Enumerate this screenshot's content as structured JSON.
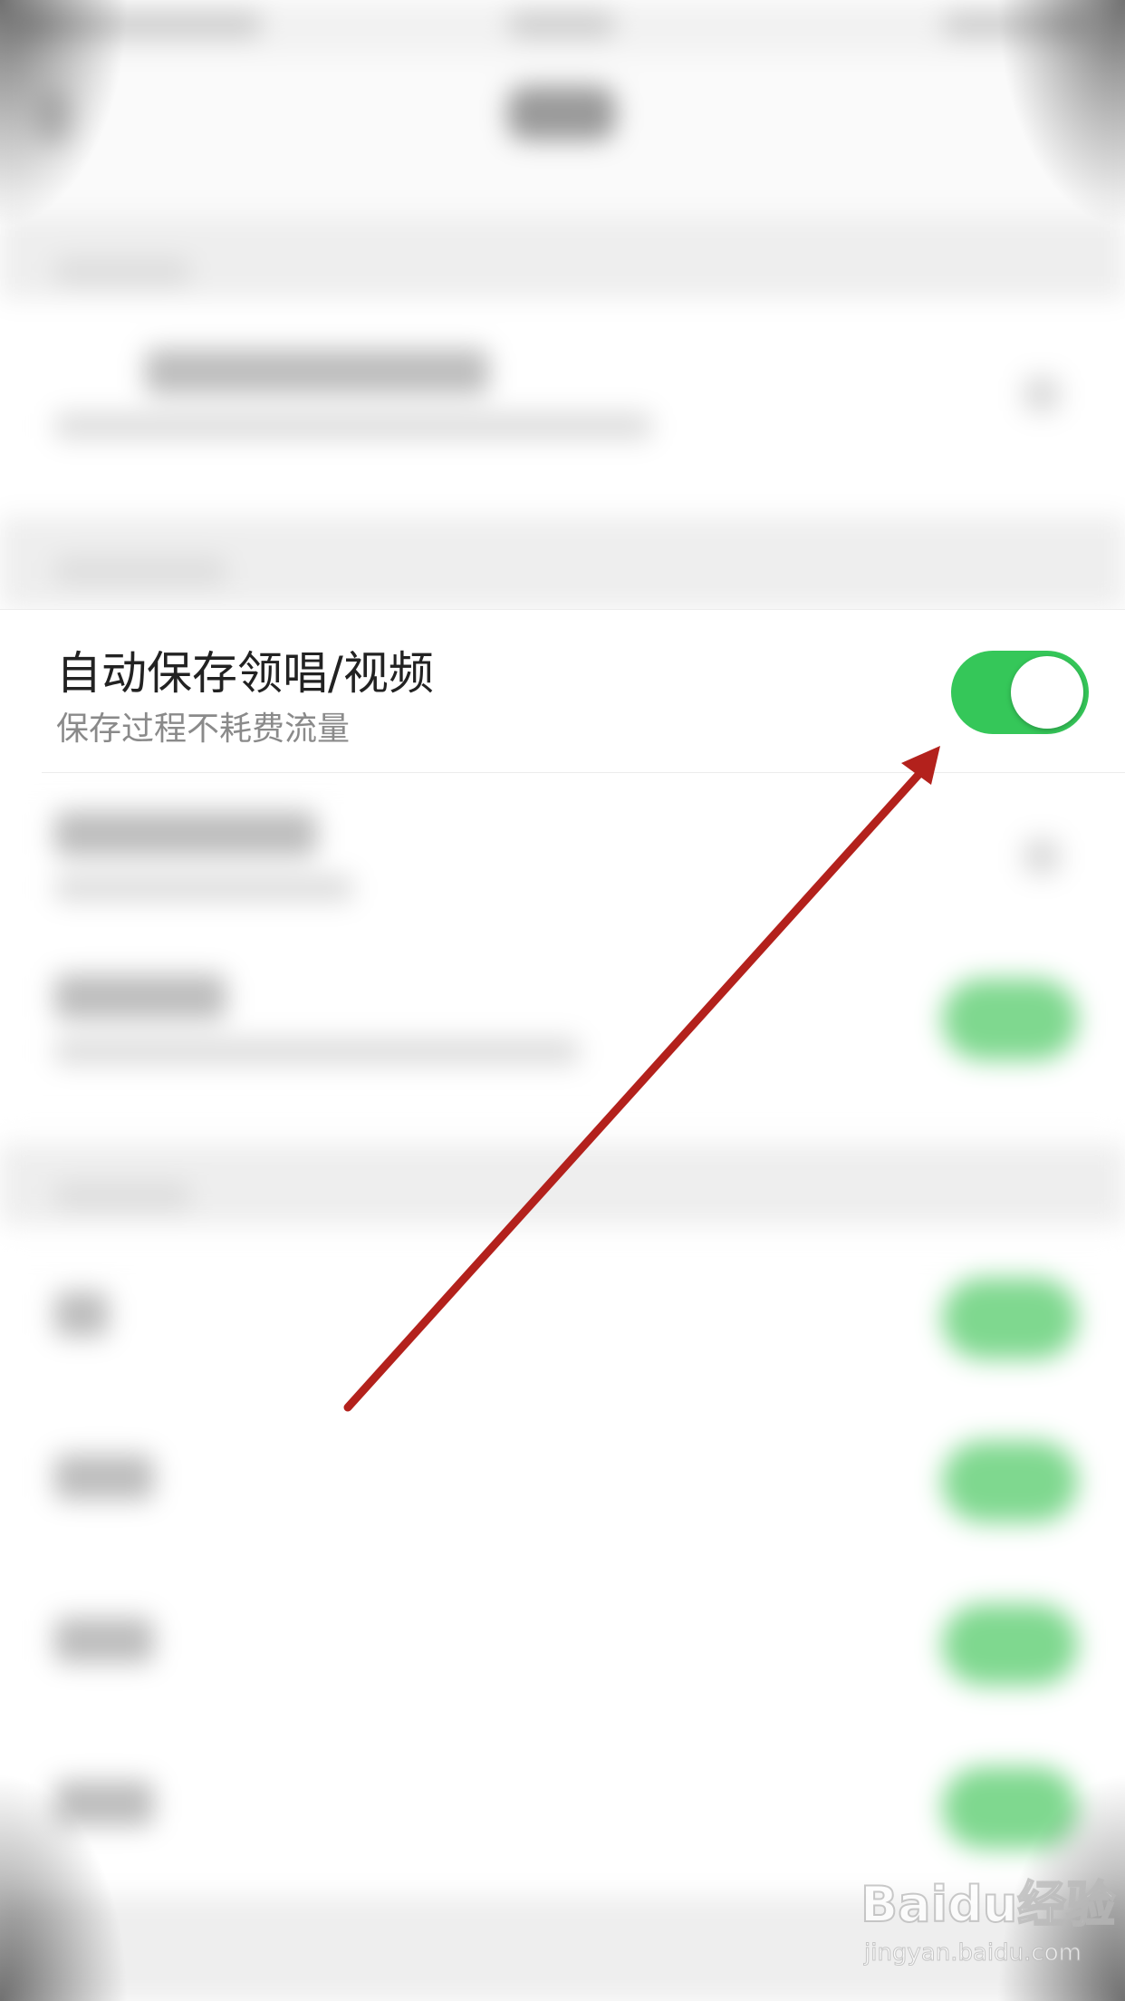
{
  "setting": {
    "title": "自动保存领唱/视频",
    "subtitle": "保存过程不耗费流量",
    "toggle_state": "on"
  },
  "colors": {
    "toggle_on": "#35c759",
    "arrow": "#b3211c",
    "title_text": "#222222",
    "subtitle_text": "#8a8a8a"
  },
  "icons": {
    "arrow": "arrow-annotation-icon",
    "watermark": "baidu-jingyan-logo"
  },
  "watermark": {
    "logo": "Baidu经验",
    "url": "jingyan.baidu.com"
  }
}
